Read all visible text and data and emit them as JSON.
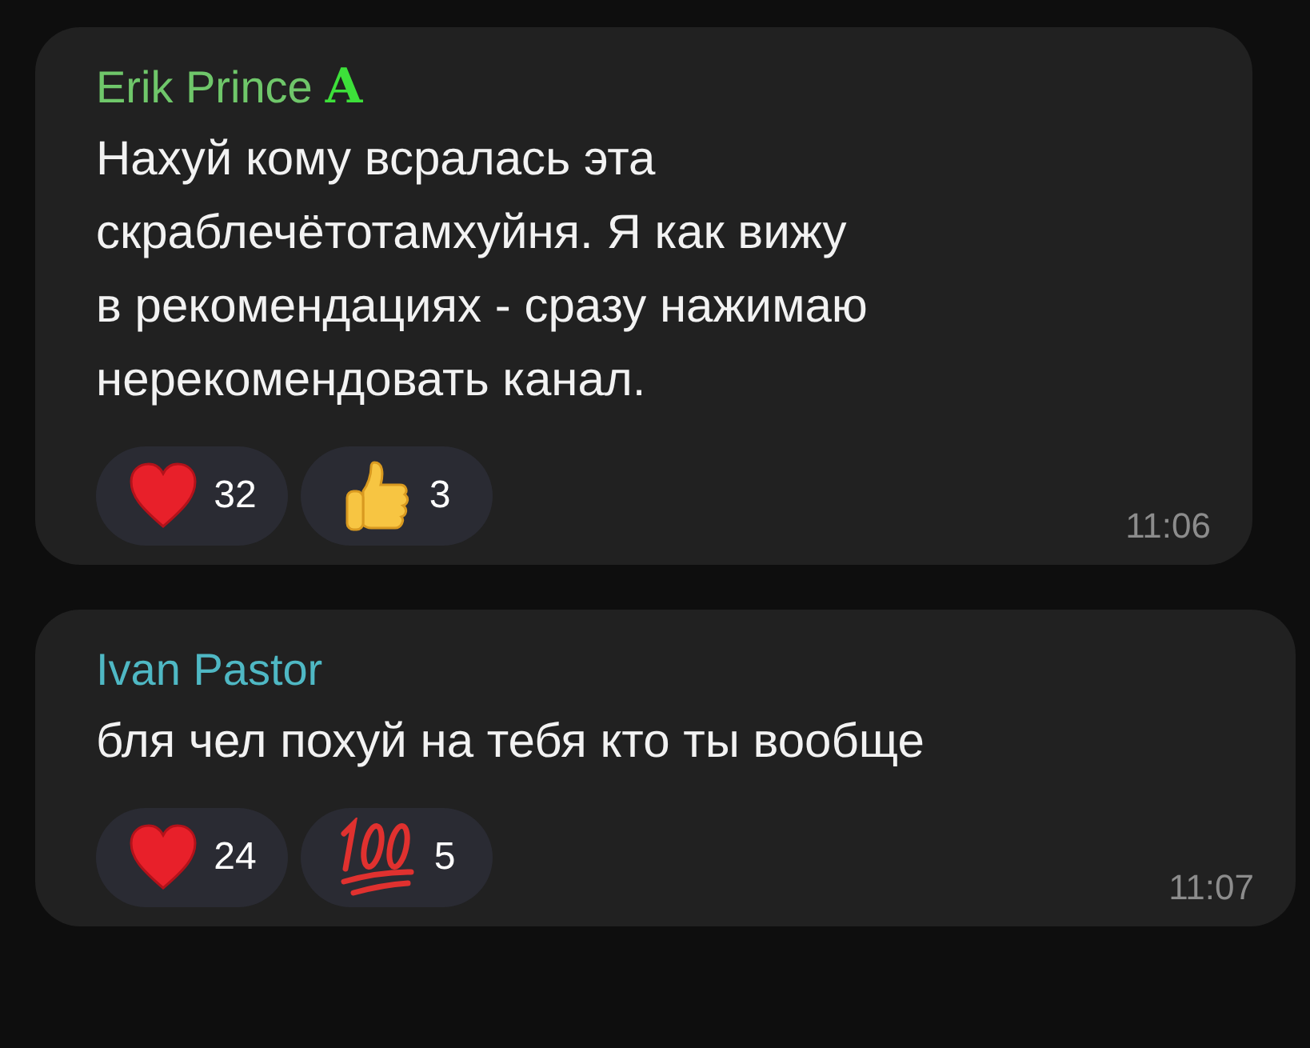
{
  "messages": [
    {
      "author": "Erik Prince",
      "color": "#6fc76a",
      "badge": "A",
      "text_lines": [
        "Нахуй кому всралась эта",
        "скраблечётотамхуйня. Я как вижу",
        "в рекомендациях - сразу нажимаю",
        "нерекомендовать канал."
      ],
      "reactions": [
        {
          "kind": "heart",
          "count": "32"
        },
        {
          "kind": "thumbs-up",
          "count": "3"
        }
      ],
      "time": "11:06"
    },
    {
      "author": "Ivan Pastor",
      "color": "#4fb8c4",
      "text_lines": [
        "бля чел похуй на тебя кто ты вообще"
      ],
      "reactions": [
        {
          "kind": "heart",
          "count": "24"
        },
        {
          "kind": "hundred",
          "count": "5"
        }
      ],
      "time": "11:07"
    }
  ]
}
